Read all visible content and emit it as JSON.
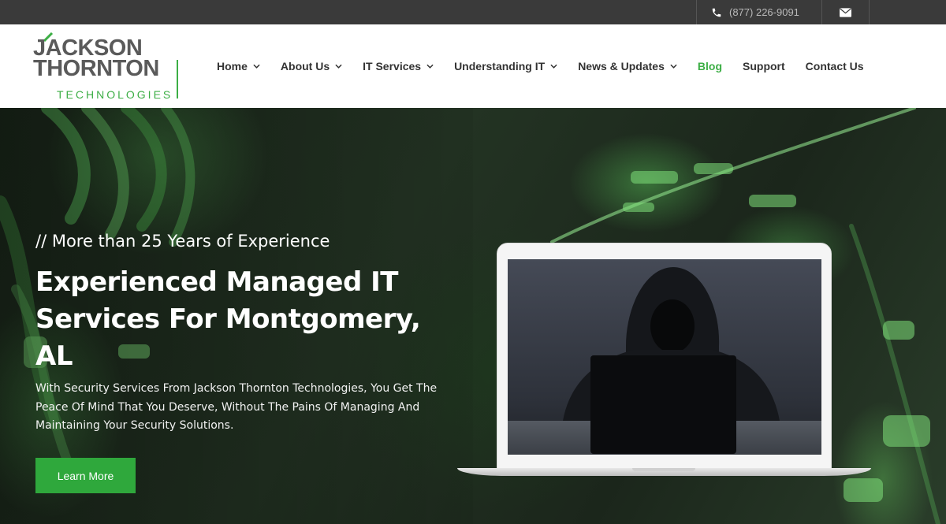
{
  "topbar": {
    "phone": "(877) 226-9091",
    "phone_icon": "phone-icon",
    "mail_icon": "envelope-icon"
  },
  "logo": {
    "line1": "JACKSON",
    "line2": "THORNTON",
    "line3": "TECHNOLOGIES"
  },
  "nav": {
    "items": [
      {
        "label": "Home",
        "dropdown": true
      },
      {
        "label": "About Us",
        "dropdown": true
      },
      {
        "label": "IT Services",
        "dropdown": true
      },
      {
        "label": "Understanding IT",
        "dropdown": true
      },
      {
        "label": "News & Updates",
        "dropdown": true
      },
      {
        "label": "Blog",
        "dropdown": false,
        "active": true
      },
      {
        "label": "Support",
        "dropdown": false
      },
      {
        "label": "Contact Us",
        "dropdown": false
      }
    ]
  },
  "hero": {
    "kicker": "// More than 25 Years of Experience",
    "headline": "Experienced Managed IT Services For Montgomery, AL",
    "subtext": "With Security Services From Jackson Thornton Technologies, You Get The Peace Of Mind That You Deserve, Without The Pains Of Managing And Maintaining Your Security Solutions.",
    "button_label": "Learn More"
  },
  "colors": {
    "accent": "#3cae45",
    "topbar": "#3a3a3a",
    "button": "#2fa83c"
  }
}
